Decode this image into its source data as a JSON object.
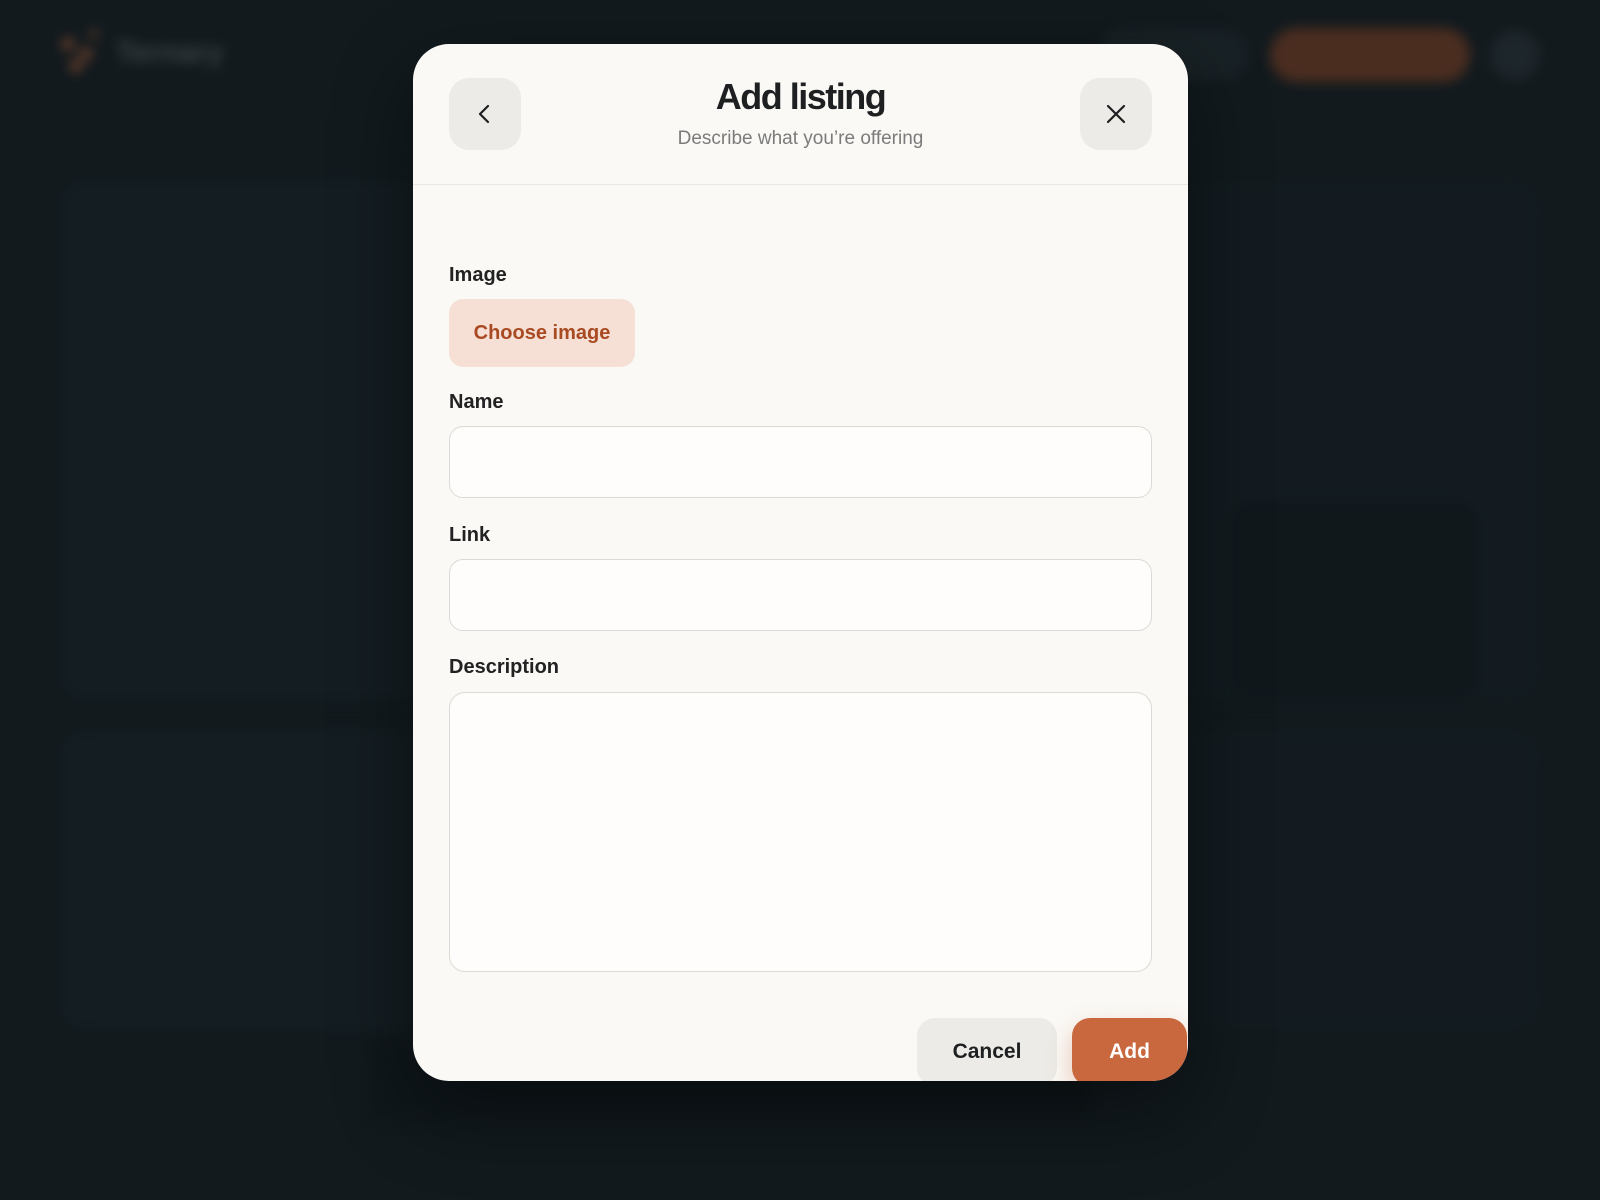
{
  "background": {
    "brand_name": "Ternary",
    "logo_icon": "logo-icon",
    "accent_color": "#c4653a"
  },
  "modal": {
    "title": "Add listing",
    "subtitle": "Describe what you’re offering",
    "back_icon": "chevron-left-icon",
    "close_icon": "close-icon",
    "fields": {
      "image_label": "Image",
      "choose_image_label": "Choose image",
      "name_label": "Name",
      "name_value": "",
      "link_label": "Link",
      "link_value": "",
      "description_label": "Description",
      "description_value": ""
    },
    "actions": {
      "cancel_label": "Cancel",
      "add_label": "Add"
    },
    "colors": {
      "accent": "#c9683e",
      "accent_soft": "#f6e0d6",
      "accent_text": "#a84a22",
      "surface": "#faf9f6",
      "backdrop": "#121a1e"
    }
  }
}
